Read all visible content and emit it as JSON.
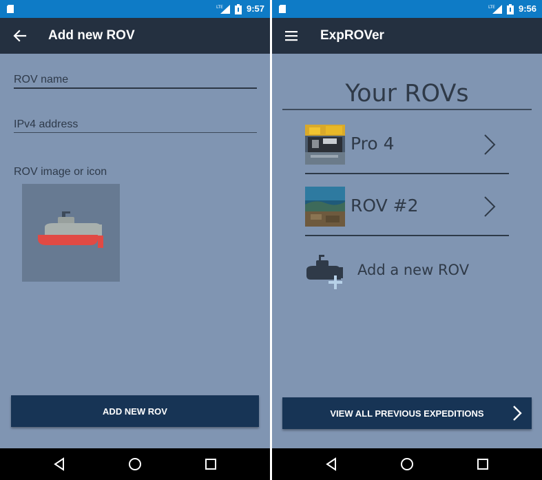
{
  "left_screen": {
    "status_bar": {
      "time": "9:57",
      "network": "LTE"
    },
    "app_bar": {
      "title": "Add new ROV",
      "nav_icon": "back-arrow-icon"
    },
    "form": {
      "name_field": {
        "placeholder": "ROV name",
        "value": ""
      },
      "ip_field": {
        "placeholder": "IPv4 address",
        "value": ""
      },
      "image_label": "ROV image or icon",
      "image_icon": "submarine-icon"
    },
    "primary_button": "ADD NEW ROV"
  },
  "right_screen": {
    "status_bar": {
      "time": "9:56",
      "network": "LTE"
    },
    "app_bar": {
      "title": "ExpROVer",
      "nav_icon": "menu-icon"
    },
    "heading": "Your ROVs",
    "rovs": [
      {
        "name": "Pro 4",
        "thumbnail": "rov-photo-yellow"
      },
      {
        "name": "ROV #2",
        "thumbnail": "rov-photo-underwater"
      }
    ],
    "add_rov_label": "Add a new ROV",
    "primary_button": "VIEW ALL PREVIOUS EXPEDITIONS"
  },
  "navigation": [
    "back-icon",
    "home-icon",
    "recents-icon"
  ],
  "colors": {
    "status_bar": "#0e7bc6",
    "app_bar": "#243040",
    "background": "#8095b2",
    "button": "#173455",
    "submarine_hull": "#e14a44",
    "submarine_body": "#a8b0ad"
  }
}
